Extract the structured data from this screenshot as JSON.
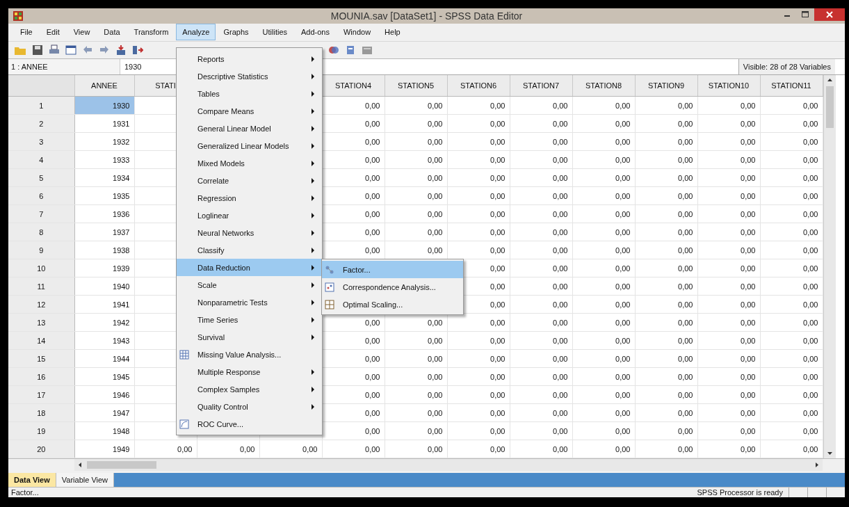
{
  "window": {
    "title": "MOUNIA.sav [DataSet1] - SPSS Data Editor"
  },
  "menu_bar": [
    {
      "label": "File",
      "selected": false
    },
    {
      "label": "Edit",
      "selected": false
    },
    {
      "label": "View",
      "selected": false
    },
    {
      "label": "Data",
      "selected": false
    },
    {
      "label": "Transform",
      "selected": false
    },
    {
      "label": "Analyze",
      "selected": true
    },
    {
      "label": "Graphs",
      "selected": false
    },
    {
      "label": "Utilities",
      "selected": false
    },
    {
      "label": "Add-ons",
      "selected": false
    },
    {
      "label": "Window",
      "selected": false
    },
    {
      "label": "Help",
      "selected": false
    }
  ],
  "cell_editor": {
    "cell": "1 : ANNEE",
    "value": "1930",
    "visible": "Visible: 28 of 28 Variables"
  },
  "table": {
    "columns": [
      "ANNEE",
      "STATI",
      null,
      null,
      "STATION4",
      "STATION5",
      "STATION6",
      "STATION7",
      "STATION8",
      "STATION9",
      "STATION10",
      "STATION11"
    ],
    "rows": [
      {
        "number": "1",
        "current": true,
        "cells": [
          "1930",
          null,
          null,
          null,
          "0,00",
          "0,00",
          "0,00",
          "0,00",
          "0,00",
          "0,00",
          "0,00",
          "0,00"
        ]
      },
      {
        "number": "2",
        "current": false,
        "cells": [
          "1931",
          null,
          null,
          null,
          "0,00",
          "0,00",
          "0,00",
          "0,00",
          "0,00",
          "0,00",
          "0,00",
          "0,00"
        ]
      },
      {
        "number": "3",
        "current": false,
        "cells": [
          "1932",
          null,
          null,
          null,
          "0,00",
          "0,00",
          "0,00",
          "0,00",
          "0,00",
          "0,00",
          "0,00",
          "0,00"
        ]
      },
      {
        "number": "4",
        "current": false,
        "cells": [
          "1933",
          null,
          null,
          null,
          "0,00",
          "0,00",
          "0,00",
          "0,00",
          "0,00",
          "0,00",
          "0,00",
          "0,00"
        ]
      },
      {
        "number": "5",
        "current": false,
        "cells": [
          "1934",
          null,
          null,
          null,
          "0,00",
          "0,00",
          "0,00",
          "0,00",
          "0,00",
          "0,00",
          "0,00",
          "0,00"
        ]
      },
      {
        "number": "6",
        "current": false,
        "cells": [
          "1935",
          null,
          null,
          null,
          "0,00",
          "0,00",
          "0,00",
          "0,00",
          "0,00",
          "0,00",
          "0,00",
          "0,00"
        ]
      },
      {
        "number": "7",
        "current": false,
        "cells": [
          "1936",
          null,
          null,
          null,
          "0,00",
          "0,00",
          "0,00",
          "0,00",
          "0,00",
          "0,00",
          "0,00",
          "0,00"
        ]
      },
      {
        "number": "8",
        "current": false,
        "cells": [
          "1937",
          null,
          null,
          null,
          "0,00",
          "0,00",
          "0,00",
          "0,00",
          "0,00",
          "0,00",
          "0,00",
          "0,00"
        ]
      },
      {
        "number": "9",
        "current": false,
        "cells": [
          "1938",
          null,
          null,
          null,
          "0,00",
          "0,00",
          "0,00",
          "0,00",
          "0,00",
          "0,00",
          "0,00",
          "0,00"
        ]
      },
      {
        "number": "10",
        "current": false,
        "cells": [
          "1939",
          null,
          null,
          null,
          null,
          null,
          "0,00",
          "0,00",
          "0,00",
          "0,00",
          "0,00",
          "0,00"
        ]
      },
      {
        "number": "11",
        "current": false,
        "cells": [
          "1940",
          null,
          null,
          null,
          null,
          null,
          "0,00",
          "0,00",
          "0,00",
          "0,00",
          "0,00",
          "0,00"
        ]
      },
      {
        "number": "12",
        "current": false,
        "cells": [
          "1941",
          null,
          null,
          null,
          null,
          null,
          "0,00",
          "0,00",
          "0,00",
          "0,00",
          "0,00",
          "0,00"
        ]
      },
      {
        "number": "13",
        "current": false,
        "cells": [
          "1942",
          null,
          null,
          null,
          "0,00",
          "0,00",
          "0,00",
          "0,00",
          "0,00",
          "0,00",
          "0,00",
          "0,00"
        ]
      },
      {
        "number": "14",
        "current": false,
        "cells": [
          "1943",
          null,
          null,
          null,
          "0,00",
          "0,00",
          "0,00",
          "0,00",
          "0,00",
          "0,00",
          "0,00",
          "0,00"
        ]
      },
      {
        "number": "15",
        "current": false,
        "cells": [
          "1944",
          null,
          null,
          null,
          "0,00",
          "0,00",
          "0,00",
          "0,00",
          "0,00",
          "0,00",
          "0,00",
          "0,00"
        ]
      },
      {
        "number": "16",
        "current": false,
        "cells": [
          "1945",
          null,
          null,
          null,
          "0,00",
          "0,00",
          "0,00",
          "0,00",
          "0,00",
          "0,00",
          "0,00",
          "0,00"
        ]
      },
      {
        "number": "17",
        "current": false,
        "cells": [
          "1946",
          null,
          null,
          null,
          "0,00",
          "0,00",
          "0,00",
          "0,00",
          "0,00",
          "0,00",
          "0,00",
          "0,00"
        ]
      },
      {
        "number": "18",
        "current": false,
        "cells": [
          "1947",
          null,
          null,
          null,
          "0,00",
          "0,00",
          "0,00",
          "0,00",
          "0,00",
          "0,00",
          "0,00",
          "0,00"
        ]
      },
      {
        "number": "19",
        "current": false,
        "cells": [
          "1948",
          null,
          null,
          null,
          "0,00",
          "0,00",
          "0,00",
          "0,00",
          "0,00",
          "0,00",
          "0,00",
          "0,00"
        ]
      },
      {
        "number": "20",
        "current": false,
        "cells": [
          "1949",
          "0,00",
          "0,00",
          "0,00",
          "0,00",
          "0,00",
          "0,00",
          "0,00",
          "0,00",
          "0,00",
          "0,00",
          "0,00"
        ]
      }
    ]
  },
  "analyze_menu": {
    "items": [
      {
        "label": "Reports",
        "kind": "submenu",
        "selected": false
      },
      {
        "label": "Descriptive Statistics",
        "kind": "submenu",
        "selected": false
      },
      {
        "label": "Tables",
        "kind": "submenu",
        "selected": false
      },
      {
        "label": "Compare Means",
        "kind": "submenu",
        "selected": false
      },
      {
        "label": "General Linear Model",
        "kind": "submenu",
        "selected": false
      },
      {
        "label": "Generalized Linear Models",
        "kind": "submenu",
        "selected": false
      },
      {
        "label": "Mixed Models",
        "kind": "submenu",
        "selected": false
      },
      {
        "label": "Correlate",
        "kind": "submenu",
        "selected": false
      },
      {
        "label": "Regression",
        "kind": "submenu",
        "selected": false
      },
      {
        "label": "Loglinear",
        "kind": "submenu",
        "selected": false
      },
      {
        "label": "Neural Networks",
        "kind": "submenu",
        "selected": false
      },
      {
        "label": "Classify",
        "kind": "submenu",
        "selected": false
      },
      {
        "label": "Data Reduction",
        "kind": "submenu",
        "selected": true
      },
      {
        "label": "Scale",
        "kind": "submenu",
        "selected": false
      },
      {
        "label": "Nonparametric Tests",
        "kind": "submenu",
        "selected": false
      },
      {
        "label": "Time Series",
        "kind": "submenu",
        "selected": false
      },
      {
        "label": "Survival",
        "kind": "submenu",
        "selected": false
      },
      {
        "label": "Missing Value Analysis...",
        "kind": "grid",
        "selected": false
      },
      {
        "label": "Multiple Response",
        "kind": "submenu",
        "selected": false
      },
      {
        "label": "Complex Samples",
        "kind": "submenu",
        "selected": false
      },
      {
        "label": "Quality Control",
        "kind": "submenu",
        "selected": false
      },
      {
        "label": "ROC Curve...",
        "kind": "curve",
        "selected": false
      }
    ]
  },
  "submenu": {
    "items": [
      {
        "label": "Factor...",
        "kind": "factor",
        "selected": true
      },
      {
        "label": "Correspondence Analysis...",
        "kind": "correspondence",
        "selected": false
      },
      {
        "label": "Optimal Scaling...",
        "kind": "scaling",
        "selected": false
      }
    ]
  },
  "view_tabs": [
    {
      "label": "Data View",
      "selected": true
    },
    {
      "label": "Variable View",
      "selected": false
    }
  ],
  "status_bar": {
    "message": "Factor...",
    "processor": "SPSS Processor is ready"
  }
}
